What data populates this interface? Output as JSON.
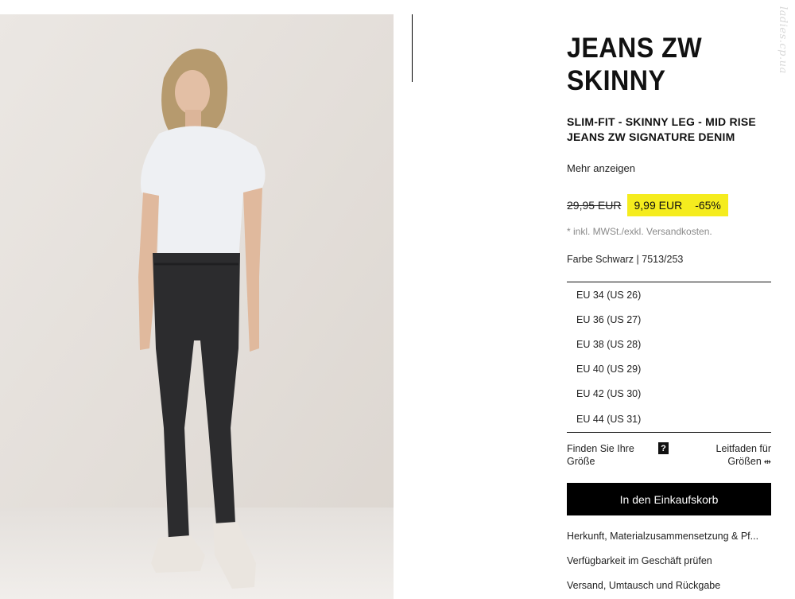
{
  "watermark": "ladies.cp.ua",
  "product": {
    "title_line1": "JEANS ZW",
    "title_line2": "SKINNY",
    "subtitle_line1": "SLIM-FIT - SKINNY LEG - MID RISE",
    "subtitle_line2": "JEANS ZW SIGNATURE DENIM",
    "more_label": "Mehr anzeigen"
  },
  "price": {
    "old": "29,95 EUR",
    "new": "9,99 EUR",
    "discount": "-65%",
    "highlight_color": "#f5ec1e",
    "tax_note": "* inkl. MWSt./exkl. Versandkosten."
  },
  "color_info": "Farbe Schwarz | 7513/253",
  "sizes": [
    "EU 34 (US 26)",
    "EU 36 (US 27)",
    "EU 38 (US 28)",
    "EU 40 (US 29)",
    "EU 42 (US 30)",
    "EU 44 (US 31)"
  ],
  "size_finder": {
    "find_line1": "Finden Sie Ihre",
    "find_line2": "Größe",
    "help_icon": "?",
    "guide_line1": "Leitfaden für",
    "guide_line2": "Größen",
    "guide_icon": "⇹"
  },
  "cart_button": "In den Einkaufskorb",
  "info_links": [
    "Herkunft, Materialzusammensetzung & Pf...",
    "Verfügbarkeit im Geschäft prüfen",
    "Versand, Umtausch und Rückgabe"
  ],
  "colors": {
    "background": "#ffffff",
    "button": "#000000",
    "photo_wall": "#e6e1dc"
  }
}
